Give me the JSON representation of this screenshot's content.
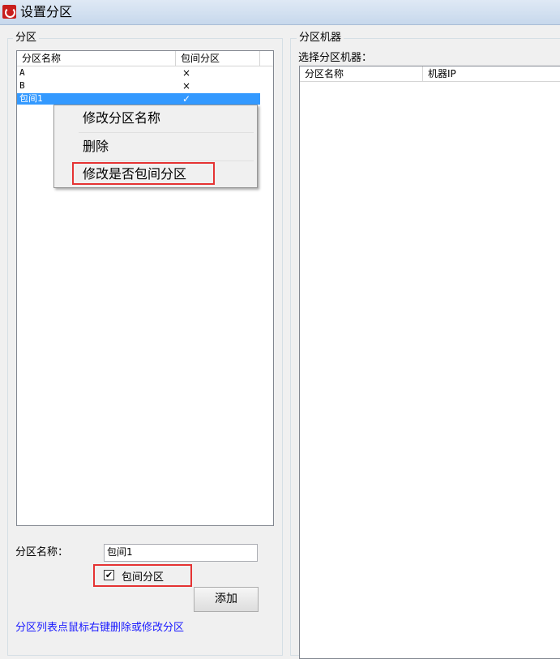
{
  "window": {
    "title": "设置分区"
  },
  "partition_group": {
    "legend": "分区",
    "columns": [
      "分区名称",
      "包间分区"
    ],
    "rows": [
      {
        "name": "A",
        "private": "×",
        "selected": false
      },
      {
        "name": "B",
        "private": "×",
        "selected": false
      },
      {
        "name": "包间1",
        "private": "✓",
        "selected": true
      }
    ],
    "context_menu": {
      "items": [
        "修改分区名称",
        "删除",
        "修改是否包间分区"
      ]
    },
    "name_label": "分区名称：",
    "name_value": "包间1",
    "private_checkbox_label": "包间分区",
    "private_checked_mark": "✔",
    "add_button": "添加",
    "hint": "分区列表点鼠标右键删除或修改分区"
  },
  "machine_group": {
    "legend": "分区机器",
    "select_label": "选择分区机器：",
    "columns": [
      "分区名称",
      "机器IP"
    ]
  }
}
